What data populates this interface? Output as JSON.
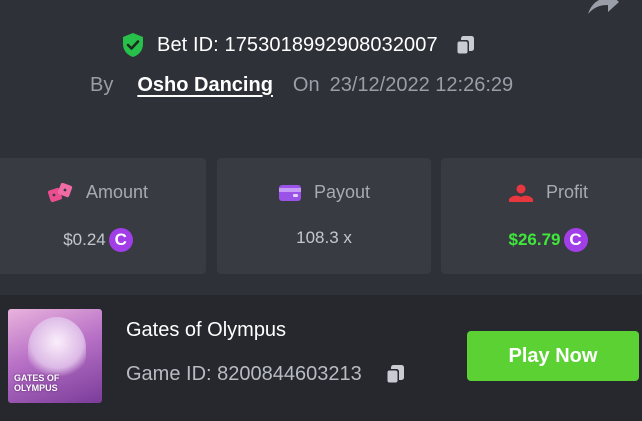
{
  "bet": {
    "id_text": "Bet ID: 1753018992908032007",
    "by_label": "By",
    "username": "Osho Dancing",
    "on_label": "On",
    "timestamp": "23/12/2022 12:26:29"
  },
  "stats": {
    "amount": {
      "label": "Amount",
      "value": "$0.24",
      "currency_icon": "coin-icon"
    },
    "payout": {
      "label": "Payout",
      "value": "108.3 x"
    },
    "profit": {
      "label": "Profit",
      "value": "$26.79",
      "currency_icon": "coin-icon"
    }
  },
  "currency_symbol": "C",
  "game": {
    "title": "Gates of Olympus",
    "id_text": "Game ID: 8200844603213",
    "thumbnail_text": "GATES OF OLYMPUS",
    "play_label": "Play Now"
  },
  "icons": {
    "verified": "shield-check-icon",
    "copy": "copy-icon",
    "share": "share-icon",
    "amount": "dice-icon",
    "payout": "wallet-icon",
    "profit": "profit-icon"
  },
  "colors": {
    "background": "#2f3138",
    "card": "#393b42",
    "game_row": "#26282e",
    "accent_green": "#5cd134",
    "profit_green": "#3ee83a",
    "coin_purple": "#a13ee8",
    "amount_icon": "#ec4d8f",
    "payout_icon": "#9a52e8",
    "profit_icon": "#e8373f"
  }
}
